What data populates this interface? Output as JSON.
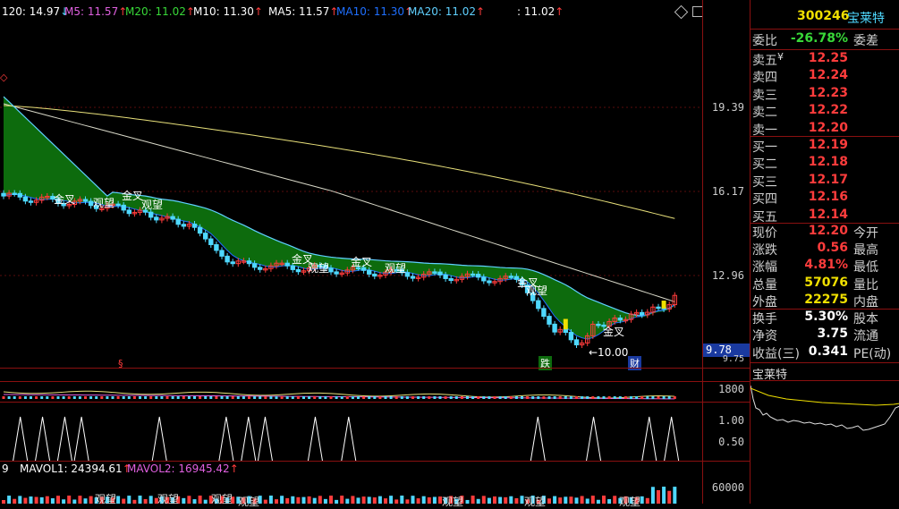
{
  "header": {
    "ma120": "120: 14.97",
    "ma120_arrow": "↓",
    "ma5": "M5: 11.57",
    "ma20": "M20: 11.02",
    "m10": "M10: 11.30",
    "ma5b": "MA5: 11.57",
    "ma10b": "MA10: 11.30",
    "ma20b": "MA20: 11.02",
    "extra": ": 11.02",
    "up_arrow": "↑"
  },
  "price_axis": [
    "19.39",
    "16.17",
    "12.96",
    "9.78",
    "9.75"
  ],
  "annotations": {
    "golden_cross": "金叉",
    "watch": "观望",
    "low_marker": "←10.00",
    "fall_tag": "跌",
    "finance_tag": "财"
  },
  "volume_axis": [
    "1800"
  ],
  "indicator_axis": [
    "1.00",
    "0.50"
  ],
  "mavol": {
    "prefix": "9",
    "mavol1": "MAVOL1: 24394.61",
    "mavol2": "MAVOL2: 16945.42",
    "axis": "60000"
  },
  "panel": {
    "code": "300246",
    "name": "宝莱特",
    "weibi_label": "委比",
    "weibi_value": "-26.78%",
    "weicha_label": "委差",
    "asks": [
      {
        "label": "卖五",
        "value": "12.25"
      },
      {
        "label": "卖四",
        "value": "12.24"
      },
      {
        "label": "卖三",
        "value": "12.23"
      },
      {
        "label": "卖二",
        "value": "12.22"
      },
      {
        "label": "卖一",
        "value": "12.20"
      }
    ],
    "bids": [
      {
        "label": "买一",
        "value": "12.19"
      },
      {
        "label": "买二",
        "value": "12.18"
      },
      {
        "label": "买三",
        "value": "12.17"
      },
      {
        "label": "买四",
        "value": "12.16"
      },
      {
        "label": "买五",
        "value": "12.14"
      }
    ],
    "stats": [
      {
        "label": "现价",
        "value": "12.20",
        "right": "今开",
        "color": "red"
      },
      {
        "label": "涨跌",
        "value": "0.56",
        "right": "最高",
        "color": "red"
      },
      {
        "label": "涨幅",
        "value": "4.81%",
        "right": "最低",
        "color": "red"
      },
      {
        "label": "总量",
        "value": "57076",
        "right": "量比",
        "color": "yellow"
      },
      {
        "label": "外盘",
        "value": "22275",
        "right": "内盘",
        "color": "yellow"
      }
    ],
    "stats2": [
      {
        "label": "换手",
        "value": "5.30%",
        "right": "股本"
      },
      {
        "label": "净资",
        "value": "3.75",
        "right": "流通"
      },
      {
        "label": "收益(三)",
        "value": "0.341",
        "right": "PE(动)"
      }
    ],
    "mini_title": "宝莱特",
    "yen": "¥"
  },
  "colors": {
    "up": "#ff3c3c",
    "down": "#4fd8ff",
    "ribbon": "#0d6b0d",
    "ma_yellow": "#e8e07a",
    "ma_white": "#d8d8c8",
    "ma_blue": "#1f6fff",
    "ma_cyan": "#5fd0ff",
    "border": "#8a1010"
  }
}
